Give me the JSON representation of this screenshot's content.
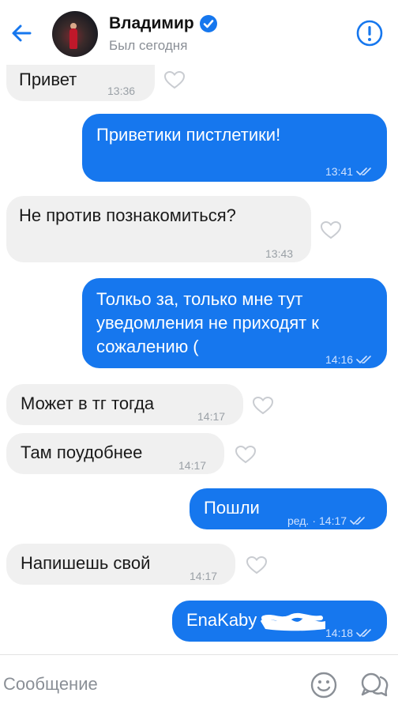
{
  "colors": {
    "accent": "#1677ee",
    "incoming_bubble": "#f0f0f0",
    "muted": "#8a8f96",
    "out_time": "#cfe2ff"
  },
  "header": {
    "name": "Владимир",
    "status": "Был сегодня",
    "back_icon": "arrow-left-icon",
    "verified_icon": "verified-badge-icon",
    "report_icon": "exclamation-circle-icon"
  },
  "messages": [
    {
      "dir": "in",
      "text": "Привет",
      "time": "13:36"
    },
    {
      "dir": "out",
      "text": "Приветики пистлетики!",
      "time": "13:41",
      "read": true
    },
    {
      "dir": "in",
      "text": "Не против познакомиться?",
      "time": "13:43"
    },
    {
      "dir": "out",
      "text": "Толкьо за, только мне тут уведомления не приходят к сожалению (",
      "time": "14:16",
      "read": true
    },
    {
      "dir": "in",
      "text": "Может в тг тогда",
      "time": "14:17"
    },
    {
      "dir": "in",
      "text": "Там поудобнее",
      "time": "14:17"
    },
    {
      "dir": "out",
      "text": "Пошли",
      "time": "14:17",
      "edited": "ред.",
      "read": true
    },
    {
      "dir": "in",
      "text": "Напишешь свой",
      "time": "14:17"
    },
    {
      "dir": "out",
      "text": "EnaKaby",
      "time": "14:18",
      "read": true
    }
  ],
  "composer": {
    "placeholder": "Сообщение",
    "emoji_icon": "smile-icon",
    "quick_icon": "chat-bubbles-icon"
  }
}
